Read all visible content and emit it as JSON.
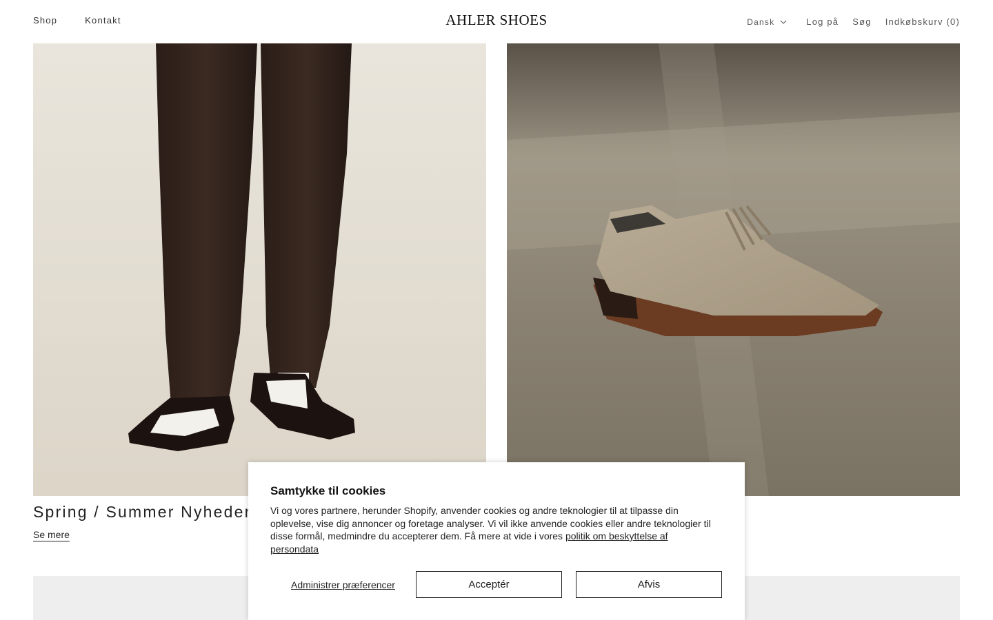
{
  "header": {
    "nav_left": [
      "Shop",
      "Kontakt"
    ],
    "logo": "AHLER SHOES",
    "language": "Dansk",
    "login": "Log på",
    "search": "Søg",
    "cart": "Indkøbskurv (0)"
  },
  "main": {
    "collection_title": "Spring / Summer Nyheder",
    "see_more": "Se mere"
  },
  "cookie": {
    "title": "Samtykke til cookies",
    "body": "Vi og vores partnere, herunder Shopify, anvender cookies og andre teknologier til at tilpasse din oplevelse, vise dig annoncer og foretage analyser. Vi vil ikke anvende cookies eller andre teknologier til disse formål, medmindre du accepterer dem. Få mere at vide i vores ",
    "policy_link": "politik om beskyttelse af persondata",
    "manage": "Administrer præferencer",
    "accept": "Acceptér",
    "reject": "Afvis"
  },
  "icons": {
    "language_dropdown": "chevron-down-icon"
  },
  "colors": {
    "text": "#1a1a1a",
    "band": "#eeeeee",
    "border": "#222222"
  }
}
